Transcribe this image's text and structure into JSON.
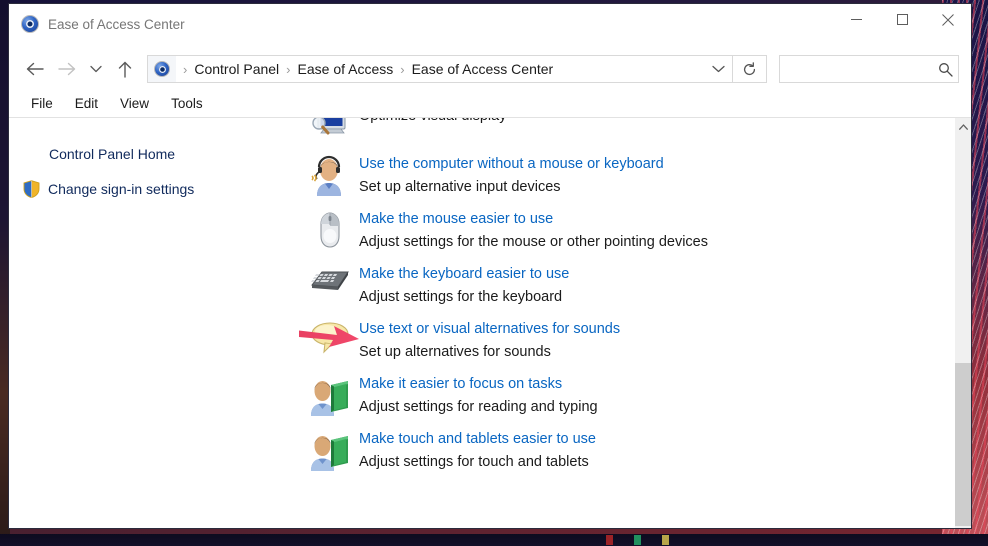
{
  "window": {
    "title": "Ease of Access Center",
    "app_icon": "control-panel-icon",
    "controls": {
      "minimize": "minimize-icon",
      "maximize": "maximize-icon",
      "close": "close-icon"
    }
  },
  "navigation": {
    "back": "back-arrow-icon",
    "forward": "forward-arrow-icon",
    "recent": "chevron-down-icon",
    "up": "up-arrow-icon",
    "refresh": "refresh-icon",
    "breadcrumb": [
      "Control Panel",
      "Ease of Access",
      "Ease of Access Center"
    ],
    "breadcrumb_separator": "›",
    "dropdown": "chevron-down-icon"
  },
  "search": {
    "value": "",
    "placeholder": "",
    "icon": "search-icon"
  },
  "menubar": {
    "items": [
      "File",
      "Edit",
      "View",
      "Tools"
    ]
  },
  "sidebar": {
    "items": [
      {
        "label": "Control Panel Home",
        "icon": null
      },
      {
        "label": "Change sign-in settings",
        "icon": "shield-icon"
      }
    ]
  },
  "content": {
    "entries": [
      {
        "icon": "monitor-magnifier-icon",
        "link": "",
        "desc": "Optimize visual display",
        "partial": true
      },
      {
        "icon": "person-headset-icon",
        "link": "Use the computer without a mouse or keyboard",
        "desc": "Set up alternative input devices",
        "partial": false
      },
      {
        "icon": "mouse-icon",
        "link": "Make the mouse easier to use",
        "desc": "Adjust settings for the mouse or other pointing devices",
        "partial": false,
        "annotated": true
      },
      {
        "icon": "keyboard-icon",
        "link": "Make the keyboard easier to use",
        "desc": "Adjust settings for the keyboard",
        "partial": false
      },
      {
        "icon": "speech-bubble-icon",
        "link": "Use text or visual alternatives for sounds",
        "desc": "Set up alternatives for sounds",
        "partial": false
      },
      {
        "icon": "person-book-icon",
        "link": "Make it easier to focus on tasks",
        "desc": "Adjust settings for reading and typing",
        "partial": false
      },
      {
        "icon": "person-book-icon",
        "link": "Make touch and tablets easier to use",
        "desc": "Adjust settings for touch and tablets",
        "partial": false
      }
    ]
  },
  "scrollbar": {
    "up": "scroll-up-icon",
    "down": "scroll-down-icon",
    "thumb": "scroll-thumb"
  },
  "annotation": {
    "type": "red-arrow",
    "points_to": "Make the mouse easier to use",
    "color": "#e8395a"
  },
  "colors": {
    "link": "#0966c2",
    "sidebar_link": "#102a5c",
    "text": "#1b1b1b",
    "title": "#767676",
    "annotation_red": "#e8395a",
    "scrollbar_thumb": "#cdcdcd",
    "window_border": "#2b2b3c"
  }
}
